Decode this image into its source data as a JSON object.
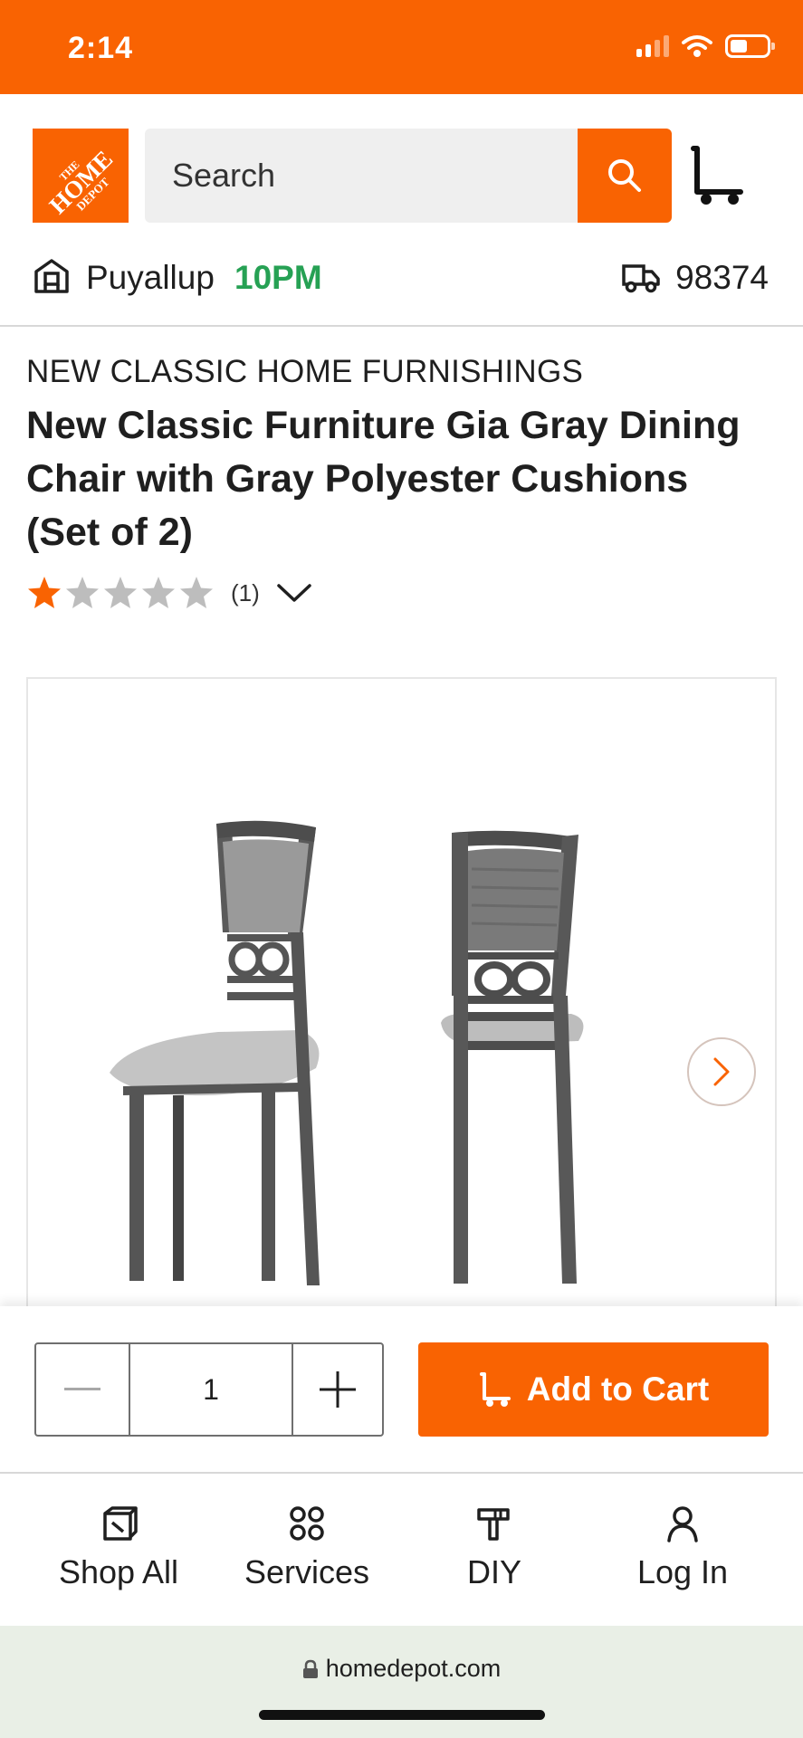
{
  "status_bar": {
    "time": "2:14"
  },
  "header": {
    "logo": {
      "line1": "THE",
      "line2": "HOME",
      "line3": "DEPOT"
    },
    "search_placeholder": "Search",
    "search_icon": "search-icon",
    "cart_icon": "cart-icon"
  },
  "store": {
    "name": "Puyallup",
    "hours": "10PM",
    "zip": "98374",
    "hours_color": "#26a154"
  },
  "product": {
    "brand": "NEW CLASSIC HOME FURNISHINGS",
    "title": "New Classic Furniture Gia Gray Dining Chair with Gray Polyester Cushions (Set of 2)",
    "rating": 1,
    "rating_max": 5,
    "review_count": "(1)"
  },
  "purchase": {
    "quantity": "1",
    "add_to_cart_label": "Add to Cart"
  },
  "bottom_nav": {
    "items": [
      {
        "label": "Shop All",
        "icon": "shop-all-icon"
      },
      {
        "label": "Services",
        "icon": "services-icon"
      },
      {
        "label": "DIY",
        "icon": "diy-hammer-icon"
      },
      {
        "label": "Log In",
        "icon": "user-icon"
      }
    ]
  },
  "browser": {
    "url": "homedepot.com"
  },
  "colors": {
    "brand_orange": "#f96302",
    "star_filled": "#f96302",
    "star_empty": "#bdbdbd"
  }
}
